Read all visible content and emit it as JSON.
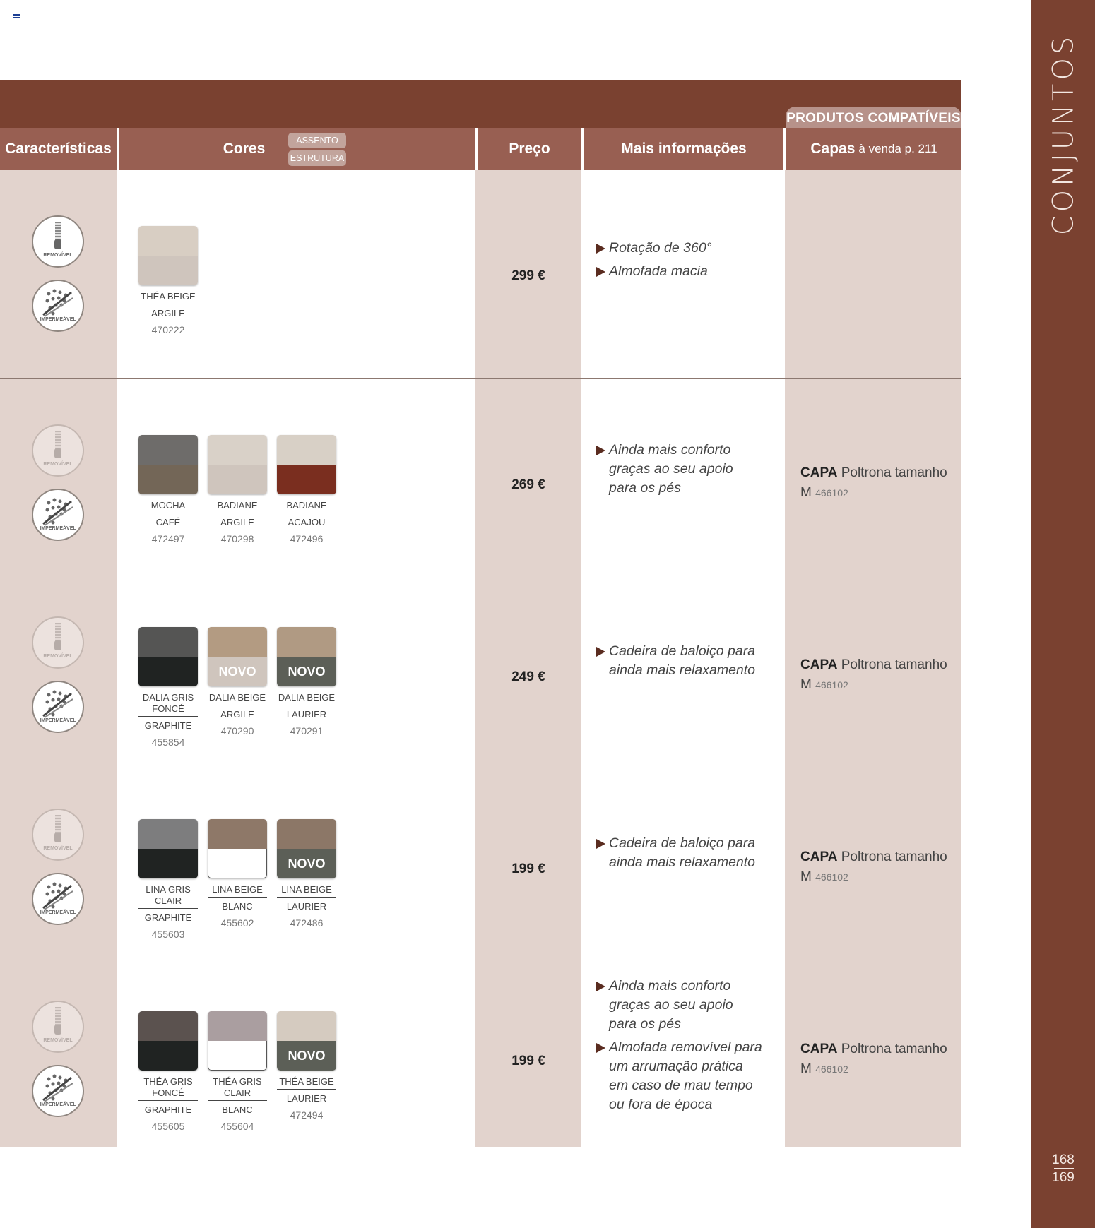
{
  "side": {
    "title": "CONJUNTOS",
    "page_left": "168",
    "page_right": "169"
  },
  "colors": {
    "brand_brown": "#7a4130",
    "header_brown": "#985f52",
    "column_tint": "#e2d3cd"
  },
  "header": {
    "compat_tab": "PRODUTOS COMPATÍVEIS",
    "caracteristicas": "Características",
    "cores": "Cores",
    "assento_pill": "ASSENTO",
    "estrutura_pill": "ESTRUTURA",
    "preco": "Preço",
    "mais_info": "Mais informações",
    "capas": "Capas",
    "capas_note": "à venda p. 211"
  },
  "badges": {
    "removivel": "REMOVÍVEL",
    "impermeavel": "IMPERMEÁVEL"
  },
  "capa_label": "CAPA",
  "capa_desc": "Poltrona tamanho M",
  "capa_code": "466102",
  "rows": [
    {
      "removivel_active": true,
      "price": "299 €",
      "info": [
        "Rotação de 360°",
        "Almofada macia"
      ],
      "capa": false,
      "swatches": [
        {
          "name": "THÉA BEIGE",
          "structure": "ARGILE",
          "code": "470222",
          "top": "#d8cec3",
          "bottom": "#cfc5bd",
          "novo": false
        }
      ]
    },
    {
      "removivel_active": false,
      "price": "269 €",
      "info": [
        "Ainda mais conforto graças ao seu apoio para os pés"
      ],
      "capa": true,
      "swatches": [
        {
          "name": "MOCHA",
          "structure": "CAFÉ",
          "code": "472497",
          "top": "#6e6c6a",
          "bottom": "#736657",
          "novo": false
        },
        {
          "name": "BADIANE",
          "structure": "ARGILE",
          "code": "470298",
          "top": "#d9d1c8",
          "bottom": "#cfc5bd",
          "novo": false
        },
        {
          "name": "BADIANE",
          "structure": "ACAJOU",
          "code": "472496",
          "top": "#d8d0c6",
          "bottom": "#7a2e1f",
          "novo": false
        }
      ]
    },
    {
      "removivel_active": false,
      "price": "249 €",
      "info": [
        "Cadeira de baloiço para ainda mais relaxamento"
      ],
      "capa": true,
      "swatches": [
        {
          "name": "DALIA GRIS FONCÉ",
          "structure": "GRAPHITE",
          "code": "455854",
          "top": "#555554",
          "bottom": "#202322",
          "novo": false
        },
        {
          "name": "DALIA BEIGE",
          "structure": "ARGILE",
          "code": "470290",
          "top": "#b39b82",
          "bottom": "#cfc5bd",
          "novo": true,
          "novo_text": "NOVO"
        },
        {
          "name": "DALIA BEIGE",
          "structure": "LAURIER",
          "code": "470291",
          "top": "#b09a83",
          "bottom": "#5c5f57",
          "novo": true,
          "novo_text": "NOVO"
        }
      ]
    },
    {
      "removivel_active": false,
      "price": "199 €",
      "info": [
        "Cadeira de baloiço para ainda mais relaxamento"
      ],
      "capa": true,
      "swatches": [
        {
          "name": "LINA GRIS CLAIR",
          "structure": "GRAPHITE",
          "code": "455603",
          "top": "#7d7d7e",
          "bottom": "#202322",
          "novo": false
        },
        {
          "name": "LINA BEIGE",
          "structure": "BLANC",
          "code": "455602",
          "top": "#8e7868",
          "bottom": "#ffffff",
          "novo": false,
          "white": true
        },
        {
          "name": "LINA BEIGE",
          "structure": "LAURIER",
          "code": "472486",
          "top": "#8c7767",
          "bottom": "#5c5f57",
          "novo": true,
          "novo_text": "NOVO"
        }
      ]
    },
    {
      "removivel_active": false,
      "price": "199 €",
      "info": [
        "Ainda mais conforto graças ao seu apoio para os pés",
        "Almofada removível para um arrumação prática em caso de mau tempo ou fora de época"
      ],
      "capa": true,
      "swatches": [
        {
          "name": "THÉA GRIS FONCÉ",
          "structure": "GRAPHITE",
          "code": "455605",
          "top": "#5b524f",
          "bottom": "#202322",
          "novo": false
        },
        {
          "name": "THÉA GRIS CLAIR",
          "structure": "BLANC",
          "code": "455604",
          "top": "#aa9ea0",
          "bottom": "#ffffff",
          "novo": false,
          "white": true
        },
        {
          "name": "THÉA BEIGE",
          "structure": "LAURIER",
          "code": "472494",
          "top": "#d5cbc0",
          "bottom": "#5c5f57",
          "novo": true,
          "novo_text": "NOVO"
        }
      ]
    }
  ]
}
